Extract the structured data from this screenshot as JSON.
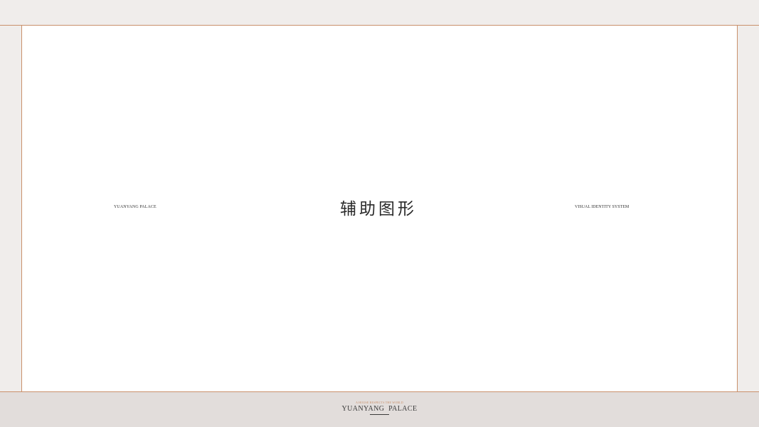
{
  "left_label": "YUANYANG  PALACE",
  "center_title": "辅助图形",
  "right_label": "VISUAL IDENTITY SYSTEM",
  "footer": {
    "tagline": "A HOUSE RESPECTS THE WORLD",
    "brand": "YUANYANG  PALACE"
  },
  "colors": {
    "accent": "#c9906b",
    "background": "#f0edeb",
    "footer_band": "#e2dddb",
    "panel": "#ffffff"
  }
}
